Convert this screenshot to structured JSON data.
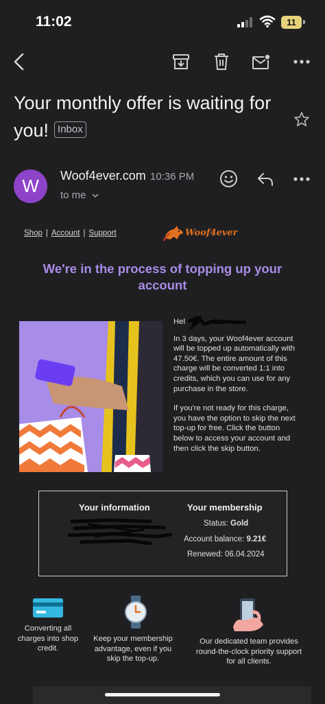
{
  "status_bar": {
    "time": "11:02",
    "battery": "11"
  },
  "toolbar": {
    "back_icon": "back-arrow-icon",
    "archive_icon": "archive-icon",
    "delete_icon": "trash-icon",
    "mark_unread_icon": "mark-unread-icon",
    "more_icon": "more-dots-icon"
  },
  "subject": {
    "title": "Your monthly offer is waiting for you!",
    "label": "Inbox"
  },
  "sender": {
    "avatar_letter": "W",
    "name": "Woof4ever.com",
    "time": "10:36 PM",
    "recipient": "to me"
  },
  "email": {
    "nav_links": [
      "Shop",
      "Account",
      "Support"
    ],
    "brand": "Woof4ever",
    "brand_color": "#e07020",
    "headline": "We're in the process of topping up your account",
    "headline_color": "#a98ce6",
    "greeting": "Hel",
    "paragraph1": "In 3 days, your Woof4ever account will be topped up automatically with 47.50€. The entire amount of this charge will be converted 1:1 into credits, which you can use for any purchase in the store.",
    "paragraph2": "If you're not ready for this charge, you have the option to skip the next top-up for free. Click the button below to access your account and then click the skip button.",
    "info": {
      "your_information_heading": "Your information",
      "membership_heading": "Your membership",
      "status_label": "Status:",
      "status_value": "Gold",
      "balance_label": "Account balance:",
      "balance_value": "9.21€",
      "renewed_label": "Renewed:",
      "renewed_value": "06.04.2024"
    },
    "features": [
      {
        "icon": "credit-card-icon",
        "text": "Converting all charges into shop credit."
      },
      {
        "icon": "watch-icon",
        "text": "Keep your membership advantage, even if you skip the top-up."
      },
      {
        "icon": "phone-hand-icon",
        "text": "Our dedicated team provides round-the-clock priority support for all clients."
      }
    ]
  }
}
